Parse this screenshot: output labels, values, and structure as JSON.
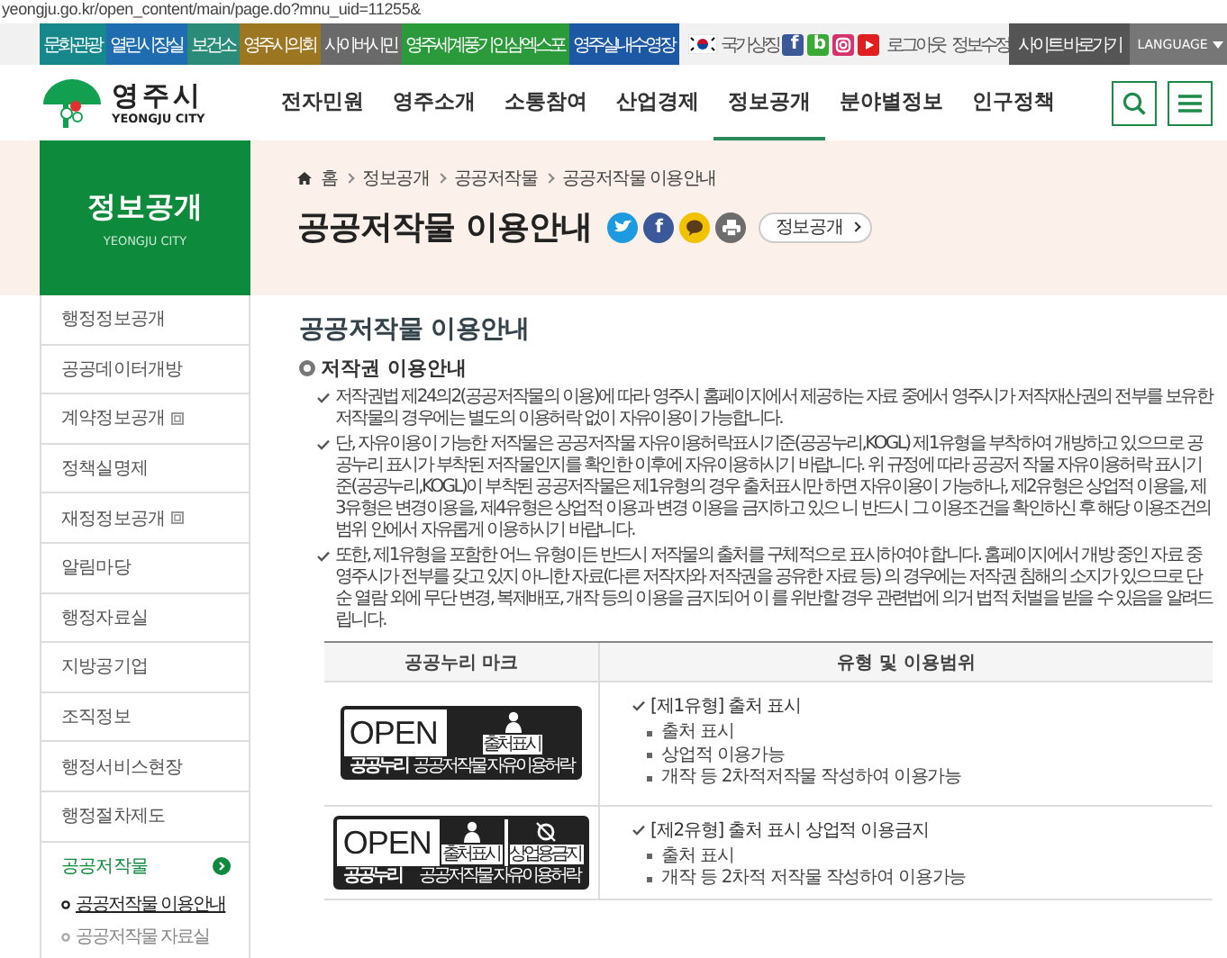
{
  "browser": {
    "url": "yeongju.go.kr/open_content/main/page.do?mnu_uid=11255&"
  },
  "quick_links": [
    {
      "label": "문화관광",
      "color": "#16878a"
    },
    {
      "label": "열린시장실",
      "color": "#1f6db0"
    },
    {
      "label": "보건소",
      "color": "#2a8c78"
    },
    {
      "label": "영주시의회",
      "color": "#9c7620"
    },
    {
      "label": "사이버시민",
      "color": "#6a6a6a"
    },
    {
      "label": "영주세계풍기인삼엑스포",
      "color": "#2b9a3b"
    },
    {
      "label": "영주실내수영장",
      "color": "#1c58a3"
    }
  ],
  "utility": {
    "national_symbol": "국가상징",
    "social": [
      {
        "kind": "letter",
        "glyph": "f",
        "color": "#3b5998"
      },
      {
        "kind": "letter",
        "glyph": "b",
        "color": "#3aa935"
      },
      {
        "kind": "camera",
        "color": "#d6336c"
      },
      {
        "kind": "play",
        "color": "#e02020"
      }
    ],
    "links": [
      "로그아웃",
      "정보수정"
    ],
    "site_shortcut": "사이트 바로가기",
    "language": "LANGUAGE"
  },
  "logo": {
    "name": "영주시",
    "sub": "YEONGJU CITY"
  },
  "nav": [
    {
      "label": "전자민원",
      "selected": false
    },
    {
      "label": "영주소개",
      "selected": false
    },
    {
      "label": "소통참여",
      "selected": false
    },
    {
      "label": "산업경제",
      "selected": false
    },
    {
      "label": "정보공개",
      "selected": true
    },
    {
      "label": "분야별정보",
      "selected": false
    },
    {
      "label": "인구정책",
      "selected": false
    }
  ],
  "sidebar": {
    "title": "정보공개",
    "sub": "YEONGJU CITY",
    "items": [
      {
        "label": "행정정보공개",
        "external": false,
        "selected": false
      },
      {
        "label": "공공데이터개방",
        "external": false,
        "selected": false
      },
      {
        "label": "계약정보공개",
        "external": true,
        "selected": false
      },
      {
        "label": "정책실명제",
        "external": false,
        "selected": false
      },
      {
        "label": "재정정보공개",
        "external": true,
        "selected": false
      },
      {
        "label": "알림마당",
        "external": false,
        "selected": false
      },
      {
        "label": "행정자료실",
        "external": false,
        "selected": false
      },
      {
        "label": "지방공기업",
        "external": false,
        "selected": false
      },
      {
        "label": "조직정보",
        "external": false,
        "selected": false
      },
      {
        "label": "행정서비스현장",
        "external": false,
        "selected": false
      },
      {
        "label": "행정절차제도",
        "external": false,
        "selected": false
      },
      {
        "label": "공공저작물",
        "external": false,
        "selected": true,
        "expanded": true,
        "children": [
          {
            "label": "공공저작물 이용안내",
            "selected": true
          },
          {
            "label": "공공저작물 자료실",
            "selected": false
          }
        ]
      }
    ]
  },
  "breadcrumb": [
    "홈",
    "정보공개",
    "공공저작물",
    "공공저작물 이용안내"
  ],
  "page_title": "공공저작물 이용안내",
  "share": [
    {
      "kind": "bird",
      "color": "#1e9be0"
    },
    {
      "kind": "letter",
      "glyph": "f",
      "color": "#3b5998"
    },
    {
      "kind": "talk",
      "color": "#f2c200"
    },
    {
      "kind": "print",
      "color": "#6d6d6d"
    }
  ],
  "menu_button": "정보공개",
  "content": {
    "title": "공공저작물 이용안내",
    "heading": "저작권 이용안내",
    "paragraphs": [
      "저작권법 제24의2(공공저작물의 이용)에 따라 영주시 홈페이지에서 제공하는 자료 중에서 영주시가 저작재산권의 전부를 보유한 저작물의 경우에는 별도의 이용허락 없이 자유이용이 가능합니다.",
      "단, 자유이용이 가능한 저작물은 공공저작물 자유이용허락표시기준(공공누리,KOGL) 제1유형을 부착하여 개방하고 있으므로 공공누리 표시가 부착된 저작물인지를 확인한 이후에 자유이용하시기 바랍니다. 위 규정에 따라 공공저 작물 자유이용허락 표시기준(공공누리,KOGL)이 부착된 공공저작물은 제1유형의 경우 출처표시만 하면 자유이용이 가능하나, 제2유형은 상업적 이용을, 제3유형은 변경이용을, 제4유형은 상업적 이용과 변경 이용을 금지하고 있으 니 반드시 그 이용조건을 확인하신 후 해당 이용조건의 범위 안에서 자유롭게 이용하시기 바랍니다.",
      "또한, 제1유형을 포함한 어느 유형이든 반드시 저작물의 출처를 구체적으로 표시하여야 합니다. 홈페이지에서 개방 중인 자료 중 영주시가 전부를 갖고 있지 아니한 자료(다른 저작자와 저작권을 공유한 자료 등) 의 경우에는 저작권 침해의 소지가 있으므로 단순 열람 외에 무단 변경, 복제배포, 개작 등의 이용을 금지되어 이 를 위반할 경우 관련법에 의거 법적 처벌을 받을 수 있음을 알려드립니다."
    ],
    "table": {
      "columns": [
        "공공누리 마크",
        "유형 및 이용범위"
      ],
      "rows": [
        {
          "title": "[제1유형] 출처 표시",
          "items": [
            "출처 표시",
            "상업적 이용가능",
            "개작 등 2차적저작물 작성하여 이용가능"
          ],
          "mark": {
            "word": "OPEN",
            "brand": "공공누리",
            "caption": "공공저작물 자유이용허락",
            "badges": [
              {
                "kind": "person",
                "label": "출처표시"
              }
            ]
          }
        },
        {
          "title": "[제2유형] 출처 표시 상업적 이용금지",
          "items": [
            "출처 표시",
            "개작 등 2차적 저작물 작성하여 이용가능"
          ],
          "mark": {
            "word": "OPEN",
            "brand": "공공누리",
            "caption": "공공저작물 자유이용허락",
            "badges": [
              {
                "kind": "person",
                "label": "출처표시"
              },
              {
                "kind": "nocommercial",
                "label": "상업용금지"
              }
            ]
          }
        }
      ]
    }
  }
}
